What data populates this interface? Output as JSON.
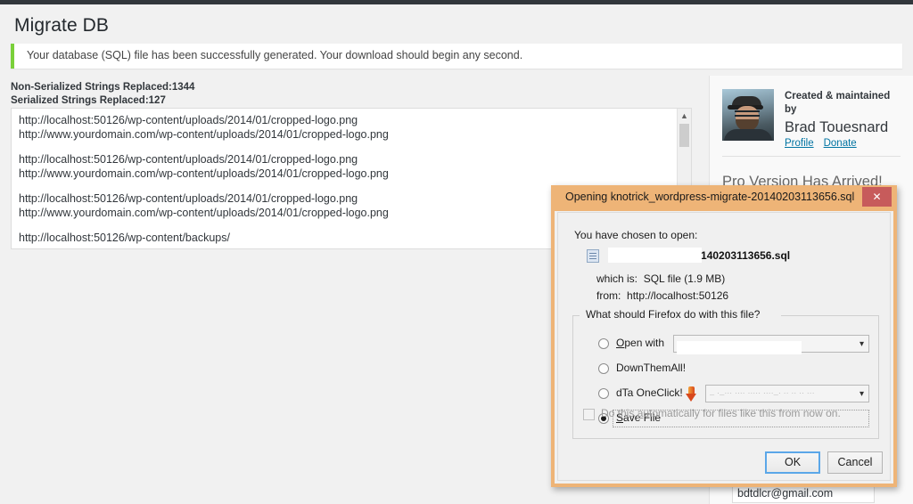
{
  "page": {
    "title": "Migrate DB",
    "notice": "Your database (SQL) file has been successfully generated. Your download should begin any second.",
    "non_serialized_count_label": "Non-Serialized Strings Replaced:1344",
    "serialized_count_label": "Serialized Strings Replaced:127"
  },
  "url_list": {
    "groups": [
      {
        "from": "http://localhost:50126/wp-content/uploads/2014/01/cropped-logo.png",
        "to": "http://www.yourdomain.com/wp-content/uploads/2014/01/cropped-logo.png"
      },
      {
        "from": "http://localhost:50126/wp-content/uploads/2014/01/cropped-logo.png",
        "to": "http://www.yourdomain.com/wp-content/uploads/2014/01/cropped-logo.png"
      },
      {
        "from": "http://localhost:50126/wp-content/uploads/2014/01/cropped-logo.png",
        "to": "http://www.yourdomain.com/wp-content/uploads/2014/01/cropped-logo.png"
      },
      {
        "from": "http://localhost:50126/wp-content/backups/",
        "to": ""
      }
    ],
    "scroll_up_icon": "chevron-up-icon"
  },
  "sidebar": {
    "created_by_label": "Created & maintained by",
    "author_name": "Brad Touesnard",
    "profile_link": "Profile",
    "donate_link": "Donate",
    "pro_heading": "Pro Version Has Arrived!",
    "email_value": "bdtdlcr@gmail.com"
  },
  "dialog": {
    "title": "Opening knotrick_wordpress-migrate-20140203113656.sql",
    "close_icon": "close-icon",
    "chosen_label": "You have chosen to open:",
    "file_icon": "file-icon",
    "file_name": "dpress-migrate-20140203113656.sql",
    "which_is_label": "which is:",
    "which_is_value": "SQL file (1.9 MB)",
    "from_label": "from:",
    "from_value": "http://localhost:50126",
    "group_legend": "What should Firefox do with this file?",
    "options": [
      {
        "label": "Open with",
        "underline_char": "O",
        "selected": false,
        "has_combo": true,
        "combo_value": ""
      },
      {
        "label": "DownThemAll!",
        "underline_char": "",
        "selected": false,
        "has_combo": false,
        "combo_value": ""
      },
      {
        "label": "dTa OneClick!",
        "underline_char": "",
        "selected": false,
        "has_combo": true,
        "combo_value": "",
        "icon": "download-arrow-icon"
      },
      {
        "label": "Save File",
        "underline_char": "S",
        "selected": true,
        "has_combo": false,
        "combo_value": ""
      }
    ],
    "auto_checkbox_label": "Do this automatically for files like this from now on.",
    "auto_checkbox_checked": false,
    "ok_label": "OK",
    "cancel_label": "Cancel"
  },
  "colors": {
    "dialog_border": "#eeb477",
    "close_button": "#c75b5b",
    "notice_accent": "#7ad03a",
    "link": "#0074a2",
    "focus_ring": "#5ba7e8"
  }
}
